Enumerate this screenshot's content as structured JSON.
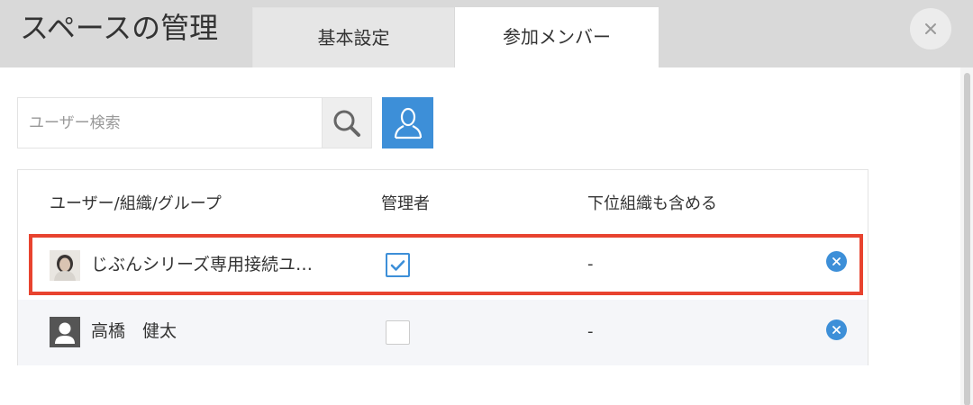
{
  "header": {
    "title": "スペースの管理",
    "tabs": [
      {
        "label": "基本設定",
        "active": false
      },
      {
        "label": "参加メンバー",
        "active": true
      }
    ],
    "close_icon": "close-icon"
  },
  "search": {
    "placeholder": "ユーザー検索",
    "search_icon": "search-icon",
    "user_select_icon": "user-icon"
  },
  "table": {
    "columns": [
      "ユーザー/組織/グループ",
      "管理者",
      "下位組織も含める"
    ],
    "rows": [
      {
        "name": "じぶんシリーズ専用接続ユ…",
        "admin": true,
        "include_sub": "-",
        "avatar": "photo-avatar",
        "highlighted": true
      },
      {
        "name": "高橋　健太",
        "admin": false,
        "include_sub": "-",
        "avatar": "person-silhouette-icon",
        "highlighted": false
      }
    ]
  },
  "colors": {
    "accent": "#3d8fd8",
    "highlight_border": "#e8432f",
    "header_bg": "#d9d9d9"
  }
}
